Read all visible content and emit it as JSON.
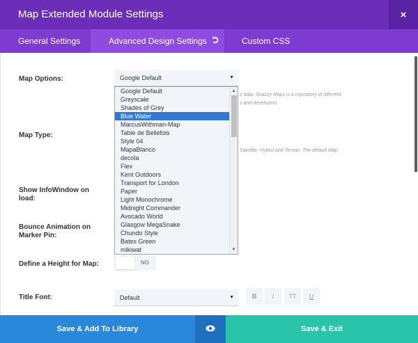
{
  "window": {
    "title": "Map Extended Module Settings",
    "close_symbol": "×"
  },
  "tabs": [
    {
      "label": "General Settings"
    },
    {
      "label": "Advanced Design Settings",
      "reset_icon": "reset-icon"
    },
    {
      "label": "Custom CSS"
    }
  ],
  "fields": {
    "map_options": {
      "label": "Map Options:",
      "value": "Google Default",
      "description_line1": "s data. Snazzy Maps is a repository of different",
      "description_line2": "s and developers."
    },
    "map_type": {
      "label": "Map Type:",
      "description": "Satellite, Hybird and Terrian. The default Map"
    },
    "show_infowindow": {
      "label_line1": "Show InfoWindow on",
      "label_line2": "load:"
    },
    "bounce_animation": {
      "label_line1": "Bounce Animation on",
      "label_line2": "Marker Pin:"
    },
    "height_for_map": {
      "label": "Define a Height for Map:",
      "toggle_text": "NO"
    },
    "title_font": {
      "label": "Title Font:",
      "value": "Default",
      "style_buttons": [
        "B",
        "I",
        "TT",
        "U"
      ]
    }
  },
  "dropdown": {
    "selected": "Blue Water",
    "options": [
      "Google Default",
      "Greyscale",
      "Shades of Grey",
      "Blue Water",
      "MarcusWithman-Map",
      "Table de Bellefois",
      "Style 04",
      "MapaBlanco",
      "decola",
      "Flex",
      "Kent Outdoors",
      "Transport for London",
      "Paper",
      "Light Monochrome",
      "Midnight Commander",
      "Avocado World",
      "Glasgow MegaSnake",
      "Chundo Style",
      "Bates Green",
      "mikiwat"
    ]
  },
  "footer": {
    "save_library": "Save & Add To Library",
    "preview_icon": "eye-icon",
    "save_exit": "Save & Exit"
  },
  "colors": {
    "title_bar": "#6c2eb9",
    "tab_bar": "#7e3bd0",
    "active_tab": "#8f4ae0",
    "selection": "#3478d2",
    "save_library": "#2b87da",
    "preview": "#1f6fbf",
    "save_exit": "#29c4a9"
  }
}
